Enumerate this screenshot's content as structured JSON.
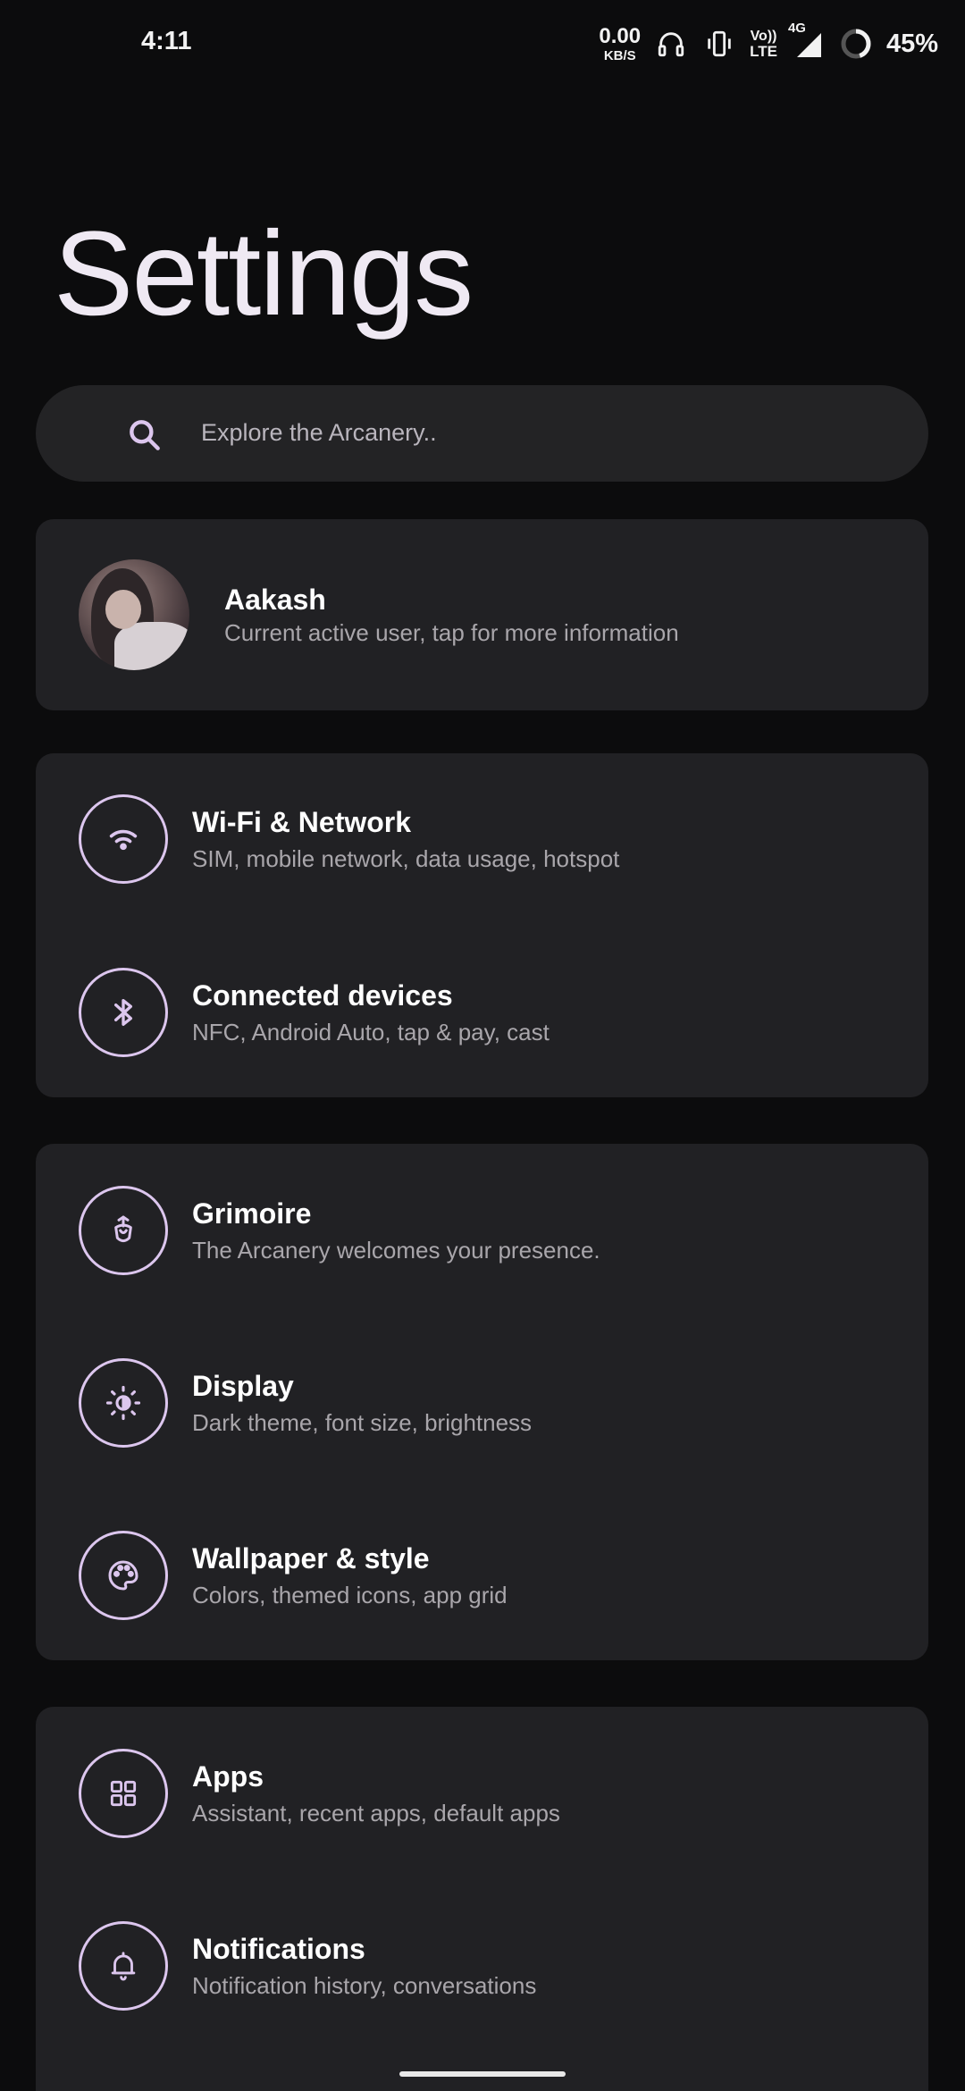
{
  "status_bar": {
    "time": "4:11",
    "net_speed_value": "0.00",
    "net_speed_unit": "KB/S",
    "volte_top": "Vo))",
    "volte_bottom": "LTE",
    "network_type": "4G",
    "battery_percent": "45%"
  },
  "header": {
    "title": "Settings"
  },
  "search": {
    "placeholder": "Explore the Arcanery.."
  },
  "user": {
    "name": "Aakash",
    "subtitle": "Current active user, tap for more information"
  },
  "groups": [
    {
      "items": [
        {
          "title": "Wi-Fi & Network",
          "subtitle": "SIM, mobile network, data usage, hotspot",
          "icon": "wifi-icon"
        },
        {
          "title": "Connected devices",
          "subtitle": "NFC, Android Auto, tap & pay, cast",
          "icon": "bluetooth-icon"
        }
      ]
    },
    {
      "items": [
        {
          "title": "Grimoire",
          "subtitle": "The Arcanery welcomes your presence.",
          "icon": "grimoire-icon"
        },
        {
          "title": "Display",
          "subtitle": "Dark theme, font size, brightness",
          "icon": "brightness-icon"
        },
        {
          "title": "Wallpaper & style",
          "subtitle": "Colors, themed icons, app grid",
          "icon": "palette-icon"
        }
      ]
    },
    {
      "items": [
        {
          "title": "Apps",
          "subtitle": "Assistant, recent apps, default apps",
          "icon": "apps-grid-icon"
        },
        {
          "title": "Notifications",
          "subtitle": "Notification history, conversations",
          "icon": "bell-icon"
        }
      ]
    }
  ],
  "colors": {
    "background": "#0c0c0d",
    "card": "#212124",
    "accent": "#dcc6ee",
    "subtitle": "#a9a6ab"
  }
}
